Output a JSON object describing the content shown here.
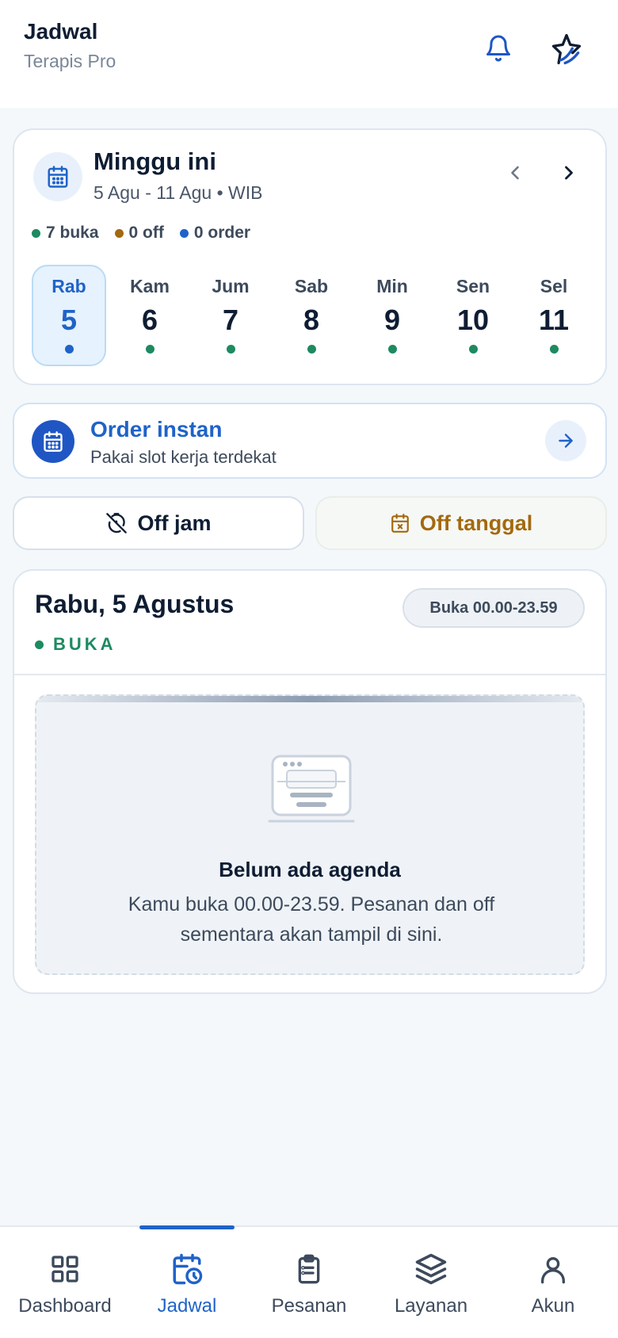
{
  "header": {
    "title": "Jadwal",
    "subtitle": "Terapis Pro",
    "icons": [
      "bell-icon",
      "brand-logo-icon"
    ]
  },
  "week": {
    "title": "Minggu ini",
    "range": "5 Agu - 11 Agu • WIB",
    "stats": [
      {
        "label": "7 buka",
        "color": "#1d8a60"
      },
      {
        "label": "0 off",
        "color": "#a3690f"
      },
      {
        "label": "0 order",
        "color": "#1f63c9"
      }
    ],
    "days": [
      {
        "name": "Rab",
        "date": "5",
        "active": true
      },
      {
        "name": "Kam",
        "date": "6",
        "active": false
      },
      {
        "name": "Jum",
        "date": "7",
        "active": false
      },
      {
        "name": "Sab",
        "date": "8",
        "active": false
      },
      {
        "name": "Min",
        "date": "9",
        "active": false
      },
      {
        "name": "Sen",
        "date": "10",
        "active": false
      },
      {
        "name": "Sel",
        "date": "11",
        "active": false
      }
    ]
  },
  "order": {
    "title": "Order instan",
    "subtitle": "Pakai slot kerja terdekat"
  },
  "actions": {
    "off_jam": "Off jam",
    "off_tanggal": "Off tanggal"
  },
  "day_detail": {
    "title": "Rabu, 5 Agustus",
    "status": "BUKA",
    "hours": "Buka 00.00-23.59",
    "empty_title": "Belum ada agenda",
    "empty_desc": "Kamu buka 00.00-23.59. Pesanan dan off sementara akan tampil di sini."
  },
  "nav": {
    "active": "Jadwal",
    "items": [
      {
        "label": "Dashboard",
        "icon": "dashboard-icon"
      },
      {
        "label": "Jadwal",
        "icon": "calendar-clock-icon"
      },
      {
        "label": "Pesanan",
        "icon": "clipboard-icon"
      },
      {
        "label": "Layanan",
        "icon": "layers-icon"
      },
      {
        "label": "Akun",
        "icon": "user-icon"
      }
    ]
  },
  "colors": {
    "primary": "#1f63c9",
    "open_green": "#1d8a60",
    "off_amber": "#a3690f",
    "background": "#f4f8fb"
  }
}
